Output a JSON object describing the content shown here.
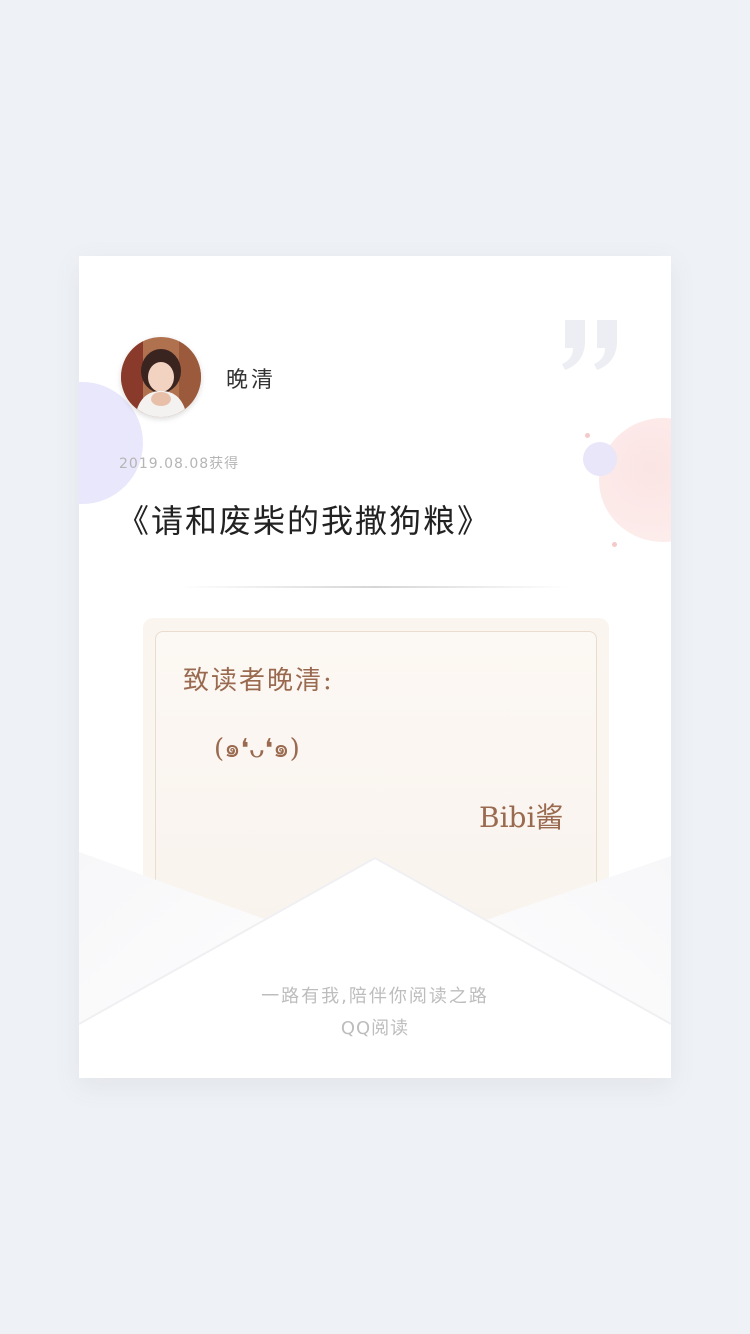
{
  "user": {
    "name": "晚清"
  },
  "obtained_text": "2019.08.08获得",
  "book_title": "《请和废柴的我撒狗粮》",
  "letter": {
    "greeting": "致读者晚清:",
    "message": "(๑❛ᴗ❛๑)",
    "signature": "Bibi酱"
  },
  "footer": {
    "slogan": "一路有我,陪伴你阅读之路",
    "brand": "QQ阅读"
  },
  "colors": {
    "background": "#eef1f5",
    "card": "#ffffff",
    "letter_text": "#9a6a50",
    "letter_paper": "#fbf5ef"
  },
  "icons": [
    "quote-mark-icon",
    "avatar-image"
  ]
}
